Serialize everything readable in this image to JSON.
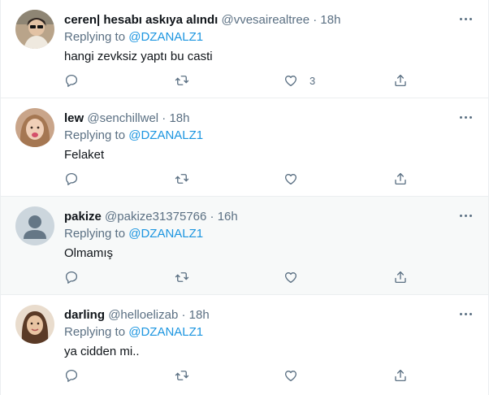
{
  "replies": [
    {
      "name": "ceren| hesabı askıya alındı",
      "handle": "@vvesairealtree",
      "time": "18h",
      "replying_prefix": "Replying to",
      "replying_handle": "@DZANALZ1",
      "text": "hangi zevksiz yaptı bu casti",
      "like_count": "3",
      "avatar": "user-photo-icon"
    },
    {
      "name": "lew",
      "handle": "@senchillwel",
      "time": "18h",
      "replying_prefix": "Replying to",
      "replying_handle": "@DZANALZ1",
      "text": "Felaket",
      "like_count": "",
      "avatar": "user-photo-icon"
    },
    {
      "name": "pakize",
      "handle": "@pakize31375766",
      "time": "16h",
      "replying_prefix": "Replying to",
      "replying_handle": "@DZANALZ1",
      "text": "Olmamış",
      "like_count": "",
      "avatar": "default-avatar-icon"
    },
    {
      "name": "darling",
      "handle": "@helloelizab",
      "time": "18h",
      "replying_prefix": "Replying to",
      "replying_handle": "@DZANALZ1",
      "text": "ya cidden mi..",
      "like_count": "",
      "avatar": "user-photo-icon"
    }
  ],
  "separator": "·",
  "colors": {
    "link": "#1b95e0",
    "secondary_text": "#5b7083",
    "primary_text": "#0f1419",
    "hover_background": "#f7f9f9",
    "divider": "#ebeef0"
  }
}
